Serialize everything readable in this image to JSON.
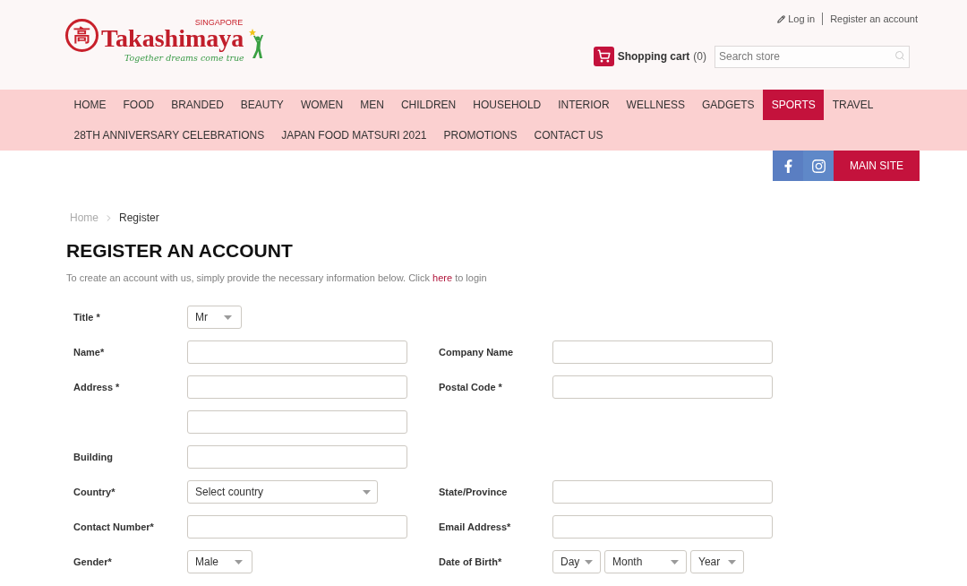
{
  "header": {
    "logo": {
      "emblem": "高",
      "wordmark": "Takashimaya",
      "region": "SINGAPORE",
      "tagline": "Together dreams come true"
    },
    "account_links": [
      {
        "label": "Log in",
        "kind": "login"
      },
      {
        "label": "Register an account",
        "kind": "register"
      }
    ],
    "cart": {
      "label": "Shopping cart",
      "count": "(0)"
    },
    "search": {
      "placeholder": "Search store"
    }
  },
  "nav": {
    "rows": [
      {
        "items": [
          {
            "label": "HOME",
            "selected": false
          },
          {
            "label": "FOOD",
            "selected": false
          },
          {
            "label": "BRANDED",
            "selected": false
          },
          {
            "label": "BEAUTY",
            "selected": false
          },
          {
            "label": "WOMEN",
            "selected": false
          },
          {
            "label": "MEN",
            "selected": false
          },
          {
            "label": "CHILDREN",
            "selected": false
          },
          {
            "label": "HOUSEHOLD",
            "selected": false
          },
          {
            "label": "INTERIOR",
            "selected": false
          },
          {
            "label": "WELLNESS",
            "selected": false
          },
          {
            "label": "GADGETS",
            "selected": false
          },
          {
            "label": "SPORTS",
            "selected": true
          },
          {
            "label": "TRAVEL",
            "selected": false
          }
        ]
      },
      {
        "items": [
          {
            "label": "28TH ANNIVERSARY CELEBRATIONS",
            "selected": false
          },
          {
            "label": "JAPAN FOOD MATSURI 2021",
            "selected": false
          },
          {
            "label": "PROMOTIONS",
            "selected": false
          },
          {
            "label": "CONTACT US",
            "selected": false
          }
        ]
      }
    ]
  },
  "social_links": [
    {
      "kind": "facebook"
    },
    {
      "kind": "instagram"
    }
  ],
  "main_site_button": "MAIN SITE",
  "breadcrumb": [
    {
      "label": "Home",
      "current": false
    },
    {
      "label": "Register",
      "current": true
    }
  ],
  "page_title": "REGISTER AN ACCOUNT",
  "intro": {
    "before": "To create an account with us, simply provide the necessary information below. Click",
    "link": "here",
    "after": "to login"
  },
  "form": {
    "rows": [
      {
        "left": {
          "label": "Title *",
          "kind": "select",
          "value": "Mr"
        }
      },
      {
        "left": {
          "label": "Name*",
          "kind": "text"
        },
        "right": {
          "label": "Company Name",
          "kind": "text"
        }
      },
      {
        "left": {
          "label": "Address *",
          "kind": "text"
        },
        "right": {
          "label": "Postal Code *",
          "kind": "text"
        }
      },
      {
        "left": {
          "kind": "text"
        }
      },
      {
        "left": {
          "label": "Building",
          "kind": "text"
        }
      },
      {
        "left": {
          "label": "Country*",
          "kind": "wideselect",
          "value": "Select country"
        },
        "right": {
          "label": "State/Province",
          "kind": "text"
        }
      },
      {
        "left": {
          "label": "Contact Number*",
          "kind": "text"
        },
        "right": {
          "label": "Email Address*",
          "kind": "text"
        }
      },
      {
        "left": {
          "label": "Gender*",
          "kind": "select",
          "value": "Male"
        },
        "right": {
          "label": "Date of Birth*",
          "kind": "date",
          "parts": [
            {
              "value": "Day"
            },
            {
              "value": "Month"
            },
            {
              "value": "Year"
            }
          ]
        }
      }
    ]
  }
}
